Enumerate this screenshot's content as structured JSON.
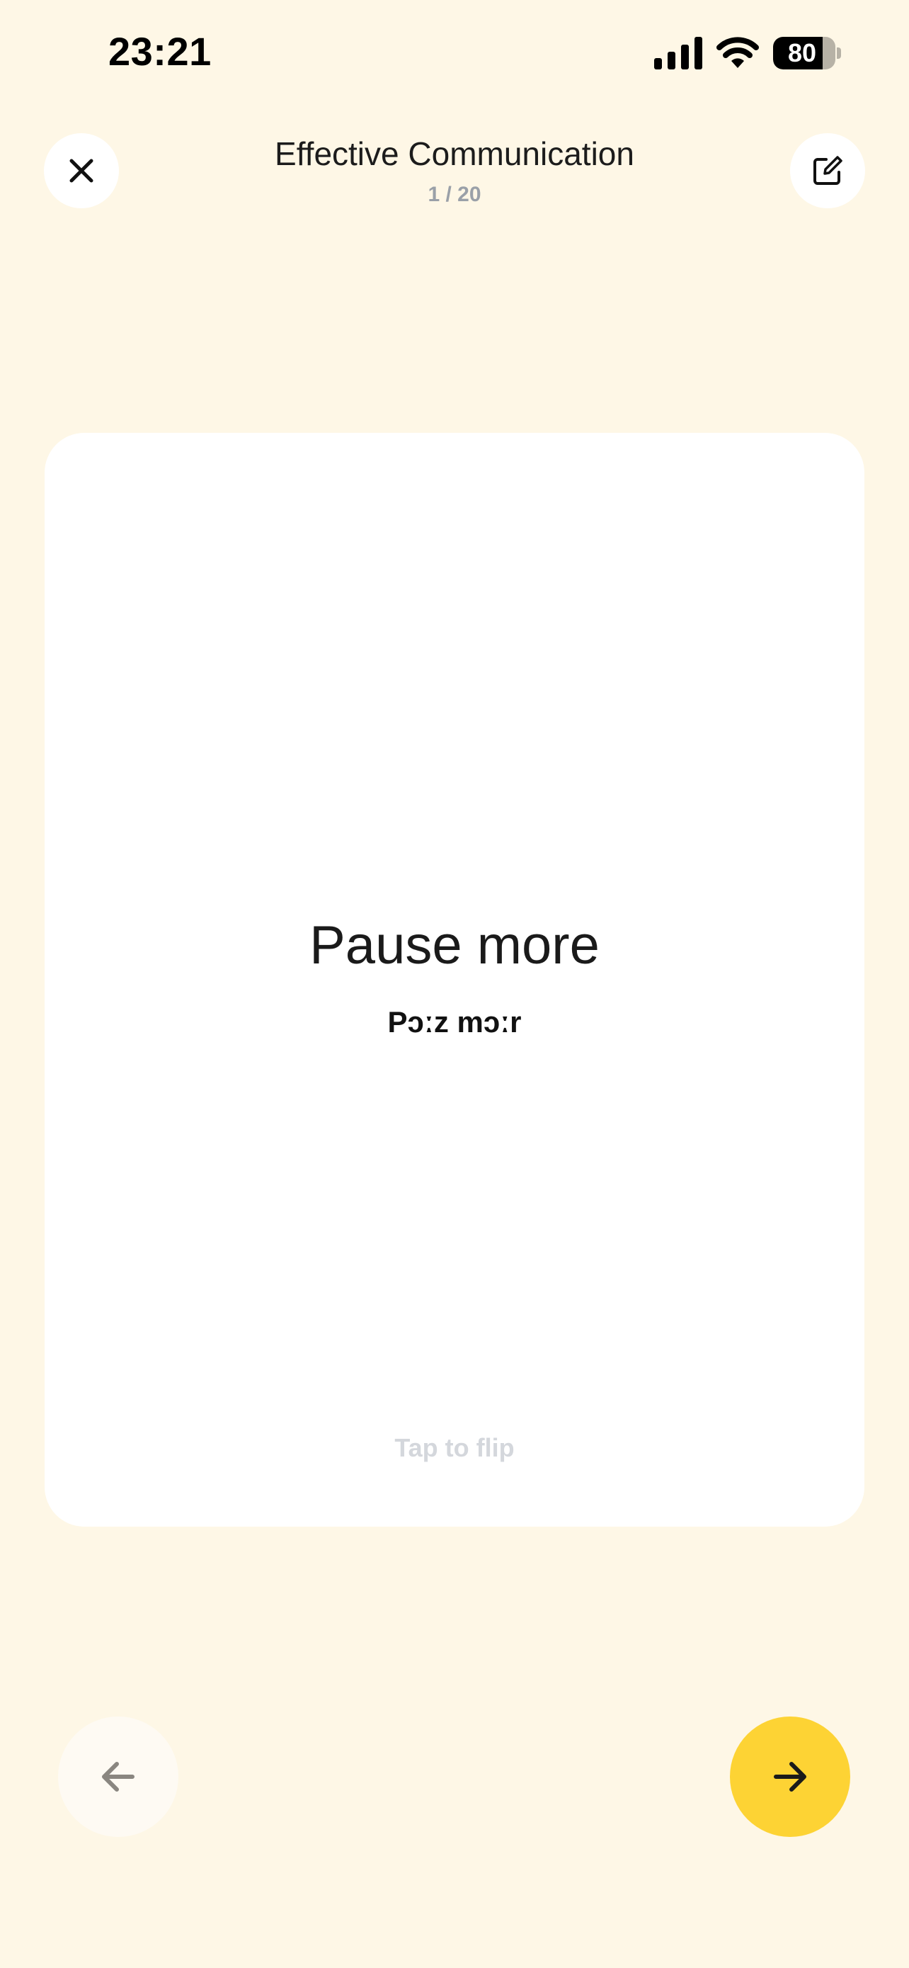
{
  "status_bar": {
    "time": "23:21",
    "battery_level": "80",
    "battery_fraction": 0.8
  },
  "header": {
    "title": "Effective Communication",
    "progress": "1 / 20"
  },
  "card": {
    "term": "Pause more",
    "phonetic": "Pɔːz mɔːr",
    "hint": "Tap to flip"
  },
  "icons": {
    "close": "close-icon",
    "edit": "edit-icon",
    "prev": "arrow-left-icon",
    "next": "arrow-right-icon",
    "signal": "cellular-signal-icon",
    "wifi": "wifi-icon",
    "battery": "battery-icon"
  },
  "colors": {
    "background": "#FEF7E6",
    "card": "#FFFFFF",
    "accent": "#FDD334",
    "muted_text": "#9AA0A8",
    "hint_text": "#D4D7DC"
  }
}
